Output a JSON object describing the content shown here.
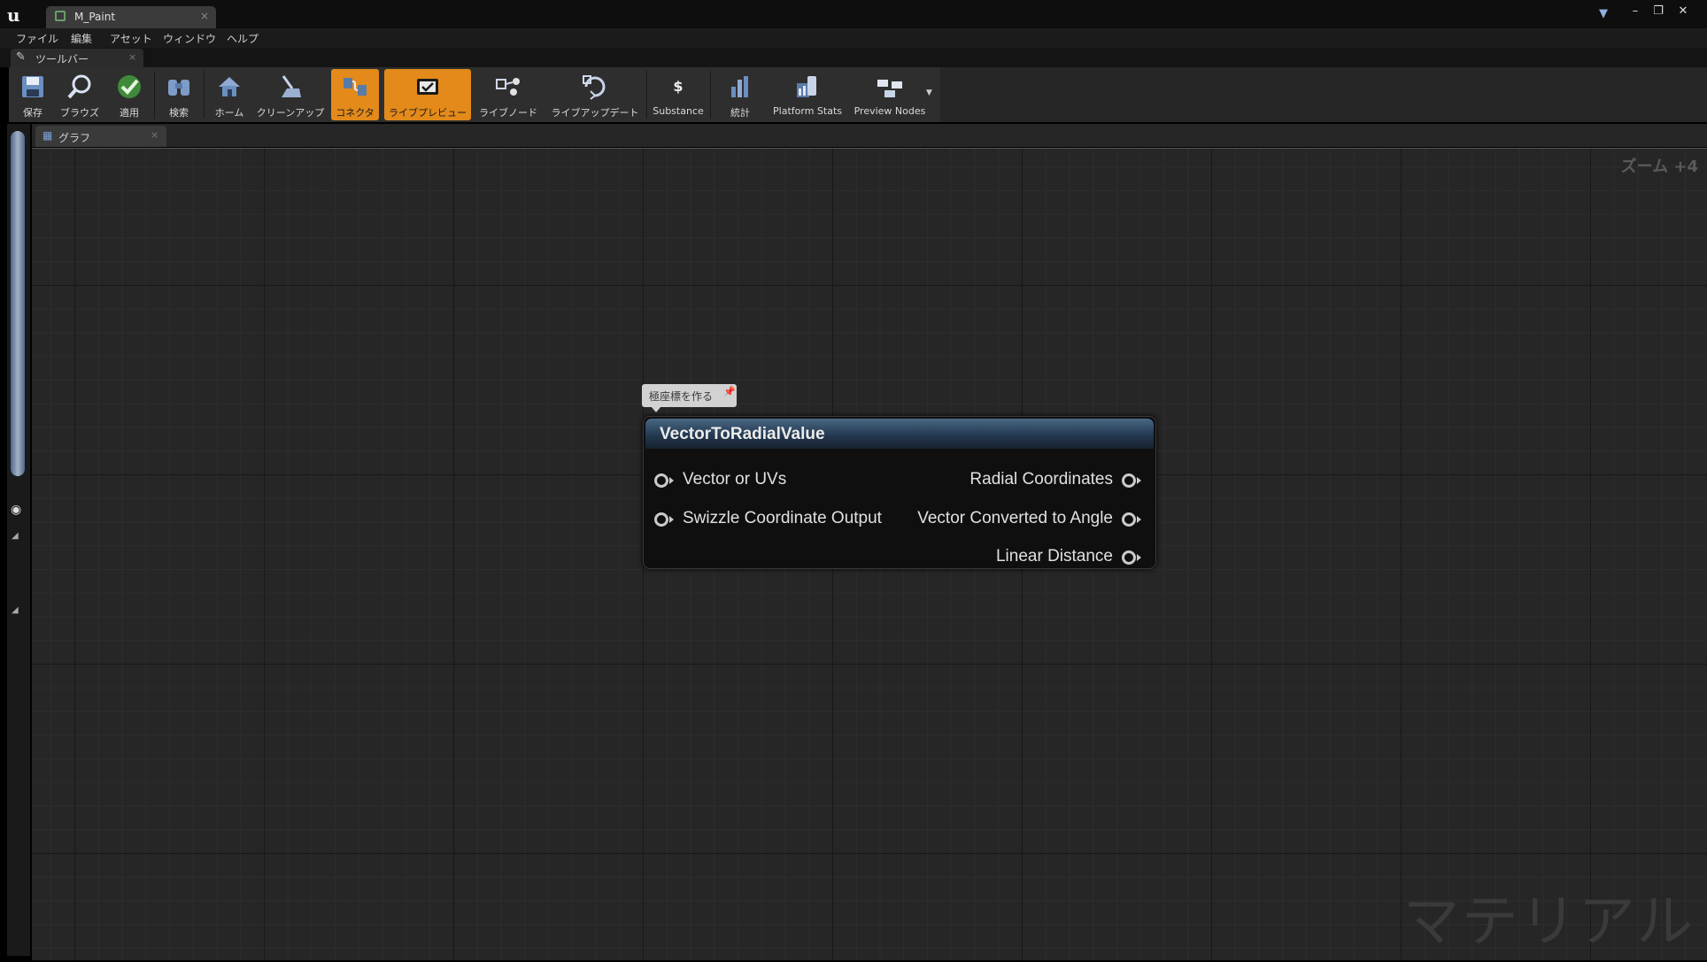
{
  "window": {
    "tab_title": "M_Paint",
    "tab_close": "×",
    "minimize": "–",
    "restore": "❐",
    "close": "✕"
  },
  "menu": [
    "ファイル",
    "編集",
    "アセット",
    "ウィンドウ",
    "ヘルプ"
  ],
  "toolbar_tab": {
    "label": "ツールバー",
    "close": "×"
  },
  "toolbar": [
    {
      "label": "保存",
      "icon": "save-icon",
      "active": false
    },
    {
      "label": "ブラウズ",
      "icon": "search-icon",
      "active": false
    },
    {
      "label": "適用",
      "icon": "check-icon",
      "active": false
    },
    {
      "label": "検索",
      "icon": "binoculars-icon",
      "active": false
    },
    {
      "label": "ホーム",
      "icon": "home-icon",
      "active": false
    },
    {
      "label": "クリーンアップ",
      "icon": "broom-icon",
      "active": false
    },
    {
      "label": "コネクタ",
      "icon": "connector-icon",
      "active": true
    },
    {
      "label": "ライブプレビュー",
      "icon": "live-preview-icon",
      "active": true
    },
    {
      "label": "ライブノード",
      "icon": "live-nodes-icon",
      "active": false
    },
    {
      "label": "ライブアップデート",
      "icon": "live-update-icon",
      "active": false
    },
    {
      "label": "Substance",
      "icon": "substance-icon",
      "active": false
    },
    {
      "label": "統計",
      "icon": "stats-icon",
      "active": false
    },
    {
      "label": "Platform Stats",
      "icon": "platform-stats-icon",
      "active": false
    },
    {
      "label": "Preview Nodes",
      "icon": "preview-nodes-icon",
      "active": false
    }
  ],
  "graph_tab": {
    "label": "グラフ",
    "close": "×"
  },
  "graph": {
    "zoom": "ズーム +4",
    "watermark": "マテリアル",
    "comment": "極座標を作る"
  },
  "node": {
    "title": "VectorToRadialValue",
    "inputs": [
      "Vector or UVs",
      "Swizzle Coordinate Output"
    ],
    "outputs": [
      "Radial Coordinates",
      "Vector Converted to Angle",
      "Linear Distance"
    ]
  },
  "colors": {
    "active_button": "#e38a1a",
    "node_header": "#3b5672",
    "graph_background": "#262626"
  }
}
